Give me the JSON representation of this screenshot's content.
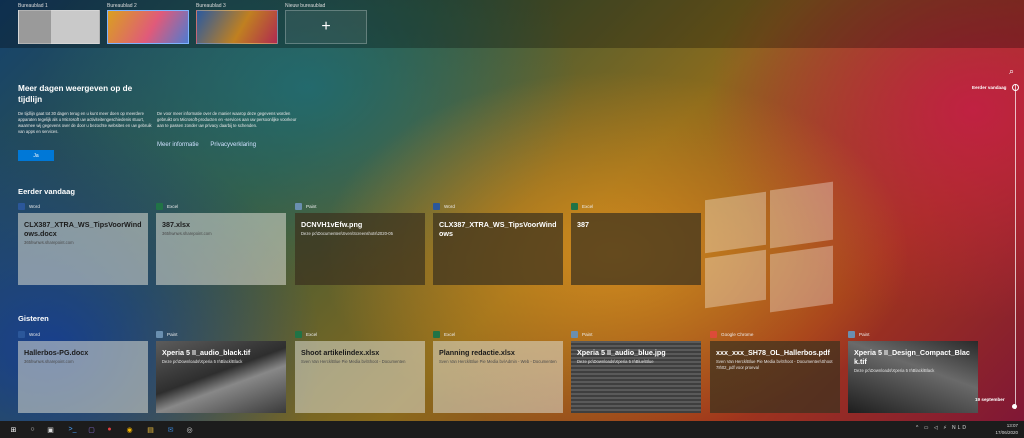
{
  "desktops": [
    {
      "label": "Bureaublad 1",
      "thumb": "linear-gradient(90deg,#9a9a9a 0 40%,#c9c9c9 40% 100%)"
    },
    {
      "label": "Bureaublad 2",
      "thumb": "linear-gradient(120deg,#d9a020,#e05a7a 55%,#4f7bd0)"
    },
    {
      "label": "Bureaublad 3",
      "thumb": "linear-gradient(120deg,#2b5aa0,#c08020 55%,#b02a50)"
    },
    {
      "label": "Nieuw bureaublad",
      "plus": "+"
    }
  ],
  "promo": {
    "title": "Meer dagen weergeven op de tijdlijn",
    "text1": "De tijdlijn gaat tot 30 dagen terug en u kunt meer doen op meerdere apparaten tegelijk als u Microsoft uw activiteitengeschiedenis stuurt, waarmee wij gegevens over de door u bezochte websites en uw gebruik van apps en services.",
    "text2": "De voor meer informatie over de manier waarop deze gegevens worden gebruikt om Microsoft-producten en -services aan uw persoonlijke voorkeur aan te passen zonder uw privacy daarbij te schenden.",
    "link1": "Meer informatie",
    "link2": "Privacyverklaring",
    "button": "Ja"
  },
  "sections": [
    {
      "title": "Eerder vandaag",
      "cards": [
        {
          "app": "Word",
          "icon_color": "#2b579a",
          "title": "CLX387_XTRA_WS_TipsVoorWindows.docx",
          "sub": "365hwnws.sharepoint.com",
          "style": "light"
        },
        {
          "app": "Excel",
          "icon_color": "#217346",
          "title": "387.xlsx",
          "sub": "365hwnws.sharepoint.com",
          "style": "light"
        },
        {
          "app": "Paint",
          "icon_color": "#6a8fb0",
          "title": "DCNVH1vEfw.png",
          "sub": "Deze pc\\Documenten\\Sven\\Screenshots\\2020-05",
          "style": "dark"
        },
        {
          "app": "Word",
          "icon_color": "#2b579a",
          "title": "CLX387_XTRA_WS_TipsVoorWindows",
          "sub": "",
          "style": "dark"
        },
        {
          "app": "Excel",
          "icon_color": "#217346",
          "title": "387",
          "sub": "",
          "style": "dark"
        }
      ]
    },
    {
      "title": "Gisteren",
      "cards": [
        {
          "app": "Word",
          "icon_color": "#2b579a",
          "title": "Hallerbos-PG.docx",
          "sub": "365hwnws.sharepoint.com",
          "style": "light"
        },
        {
          "app": "Paint",
          "icon_color": "#6a8fb0",
          "title": "Xperia 5 II_audio_black.tif",
          "sub": "Deze pc\\Downloads\\Xperia 5 II\\Black\\Black",
          "style": "photo1"
        },
        {
          "app": "Excel",
          "icon_color": "#217346",
          "title": "Shoot artikelindex.xlsx",
          "sub": "Sven Van Herck\\Blue Pie Media bv\\Shoot - Documenten",
          "style": "light"
        },
        {
          "app": "Excel",
          "icon_color": "#217346",
          "title": "Planning redactie.xlsx",
          "sub": "Sven Van Herck\\Blue Pie Media bv\\Admin - Web - Documenten",
          "style": "light"
        },
        {
          "app": "Paint",
          "icon_color": "#6a8fb0",
          "title": "Xperia 5 II_audio_blue.jpg",
          "sub": "Deze pc\\Downloads\\Xperia 5 II\\Blue\\Blue",
          "style": "photo2"
        },
        {
          "app": "Google Chrome",
          "icon_color": "#dd4b39",
          "title": "xxx_xxx_SH78_OL_Hallerbos.pdf",
          "sub": "Sven Van Herck\\Blue Pie Media bv\\Shoot - Documenten\\Shoot 78\\02_pdf voor proeval",
          "style": "dark"
        },
        {
          "app": "Paint",
          "icon_color": "#6a8fb0",
          "title": "Xperia 5 II_Design_Compact_Black.tif",
          "sub": "Deze pc\\Downloads\\Xperia 5 II\\Black\\Black",
          "style": "photo3"
        }
      ]
    }
  ],
  "timeline": {
    "top_label": "Eerder vandaag",
    "bottom_label": "19 september"
  },
  "taskbar": {
    "icons": [
      "start-icon",
      "search-icon",
      "task-view-icon",
      "terminal-icon",
      "app-icon-purple",
      "app-icon-red",
      "chrome-icon",
      "files-icon",
      "outlook-icon",
      "app-icon-circle"
    ],
    "tray": "^ ▭ ◁ ⚡ NLD",
    "time": "13:07",
    "date": "17/06/2020"
  }
}
